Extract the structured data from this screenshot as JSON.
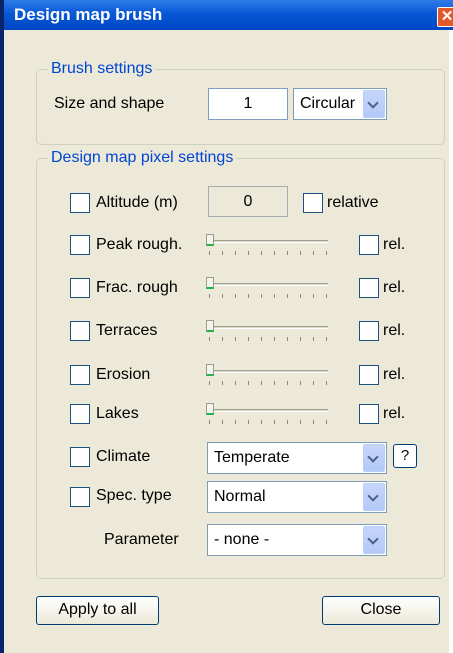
{
  "window": {
    "title": "Design map brush",
    "close_glyph": "✕"
  },
  "brush_settings": {
    "legend": "Brush settings",
    "size_label": "Size and shape",
    "size_value": "1",
    "shape_value": "Circular"
  },
  "pixel_settings": {
    "legend": "Design map pixel settings",
    "altitude": {
      "label": "Altitude (m)",
      "value": "0",
      "relative_label": "relative",
      "checked": false
    },
    "sliders": [
      {
        "label": "Peak rough.",
        "rel_label": "rel.",
        "level": 0
      },
      {
        "label": "Frac. rough",
        "rel_label": "rel.",
        "level": 0
      },
      {
        "label": "Terraces",
        "rel_label": "rel.",
        "level": 0
      },
      {
        "label": "Erosion",
        "rel_label": "rel.",
        "level": 0
      },
      {
        "label": "Lakes",
        "rel_label": "rel.",
        "level": 0
      }
    ],
    "climate": {
      "label": "Climate",
      "value": "Temperate",
      "help": "?"
    },
    "spec_type": {
      "label": "Spec. type",
      "value": "Normal"
    },
    "parameter": {
      "label": "Parameter",
      "value": "- none -"
    }
  },
  "buttons": {
    "apply_all": "Apply to all",
    "close": "Close"
  },
  "colors": {
    "titlebar": "#0858d6",
    "group_label": "#0046d5",
    "dialog_bg": "#ece9d8"
  }
}
